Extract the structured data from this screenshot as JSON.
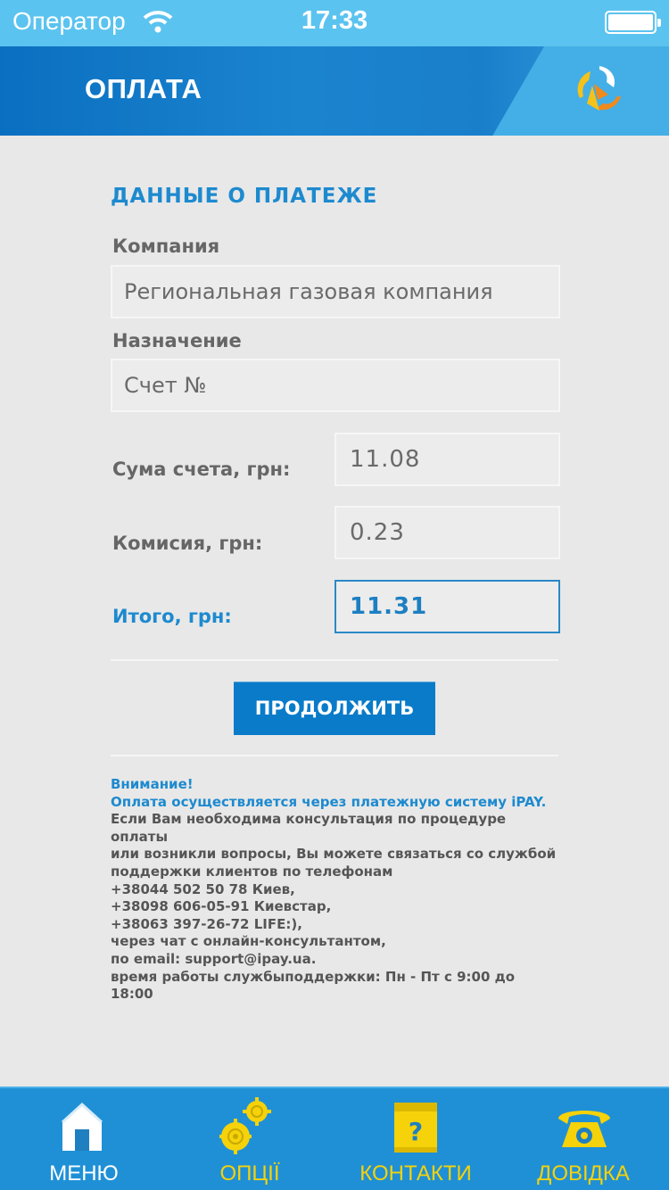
{
  "status_bar": {
    "carrier": "Оператор",
    "time": "17:33"
  },
  "header": {
    "title": "ОПЛАТА"
  },
  "payment": {
    "section_title": "ДАННЫЕ О ПЛАТЕЖЕ",
    "company_label": "Компания",
    "company_value": "Региональная газовая компания",
    "purpose_label": "Назначение",
    "purpose_value": "Счет №",
    "amount_label": "Сума счета, грн:",
    "amount_value": "11.08",
    "commission_label": "Комисия, грн:",
    "commission_value": "0.23",
    "total_label": "Итого, грн:",
    "total_value": "11.31",
    "continue_button": "ПРОДОЛЖИТЬ"
  },
  "notice": {
    "attention": "Внимание!",
    "system": "Оплата осуществляется через платежную систему iPAY.",
    "line1": "Если Вам необходима консультация по процедуре оплаты",
    "line2": "или возникли вопросы, Вы можете связаться со службой",
    "line3": "поддержки клиентов по телефонам",
    "phone1": "+38044 502 50 78 Киев,",
    "phone2": "+38098 606-05-91 Киевстар,",
    "phone3": "+38063 397-26-72 LIFE:),",
    "chat": "через чат с онлайн-консультантом,",
    "email": "по email: support@ipay.ua.",
    "hours": "время работы службыподдержки: Пн - Пт с 9:00 до 18:00"
  },
  "tabs": [
    {
      "label": "МЕНЮ",
      "icon": "home-icon",
      "color": "#ffffff"
    },
    {
      "label": "ОПЦІЇ",
      "icon": "gears-icon",
      "color": "#f5d20a"
    },
    {
      "label": "КОНТАКТИ",
      "icon": "help-book-icon",
      "color": "#f5d20a"
    },
    {
      "label": "ДОВІДКА",
      "icon": "phone-icon",
      "color": "#f5d20a"
    }
  ],
  "colors": {
    "accent": "#1d8acf",
    "header_blue": "#0a6fc0",
    "status_bar": "#5bc3ef",
    "tab_bar": "#1f90d6",
    "tab_yellow": "#f5d20a"
  }
}
